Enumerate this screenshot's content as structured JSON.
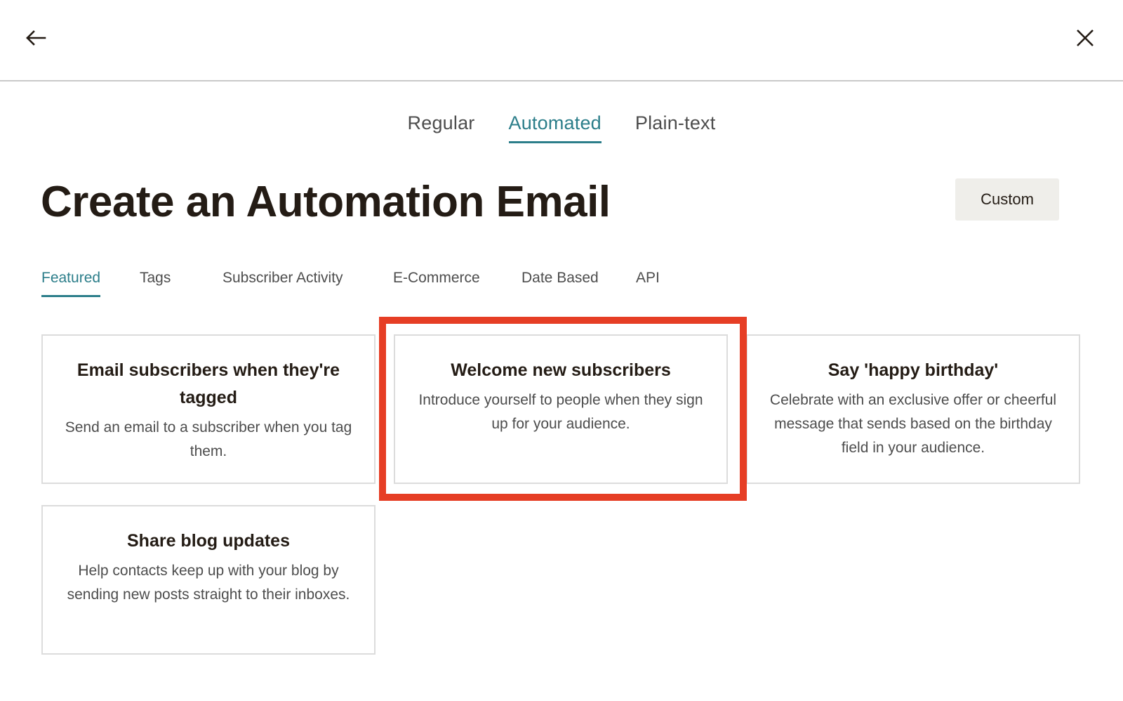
{
  "header": {
    "back_icon": "arrow-left-icon",
    "close_icon": "close-icon"
  },
  "type_tabs": [
    {
      "label": "Regular",
      "active": false
    },
    {
      "label": "Automated",
      "active": true
    },
    {
      "label": "Plain-text",
      "active": false
    }
  ],
  "page": {
    "title": "Create an Automation Email",
    "custom_button": "Custom"
  },
  "category_tabs": [
    {
      "label": "Featured",
      "active": true
    },
    {
      "label": "Tags",
      "active": false
    },
    {
      "label": "Subscriber Activity",
      "active": false
    },
    {
      "label": "E-Commerce",
      "active": false
    },
    {
      "label": "Date Based",
      "active": false
    },
    {
      "label": "API",
      "active": false
    }
  ],
  "cards": [
    {
      "title": "Email subscribers when they're tagged",
      "description": "Send an email to a subscriber when you tag them."
    },
    {
      "title": "Welcome new subscribers",
      "description": "Introduce yourself to people when they sign up for your audience."
    },
    {
      "title": "Say 'happy birthday'",
      "description": "Celebrate with an exclusive offer or cheerful message that sends based on the birthday field in your audience."
    },
    {
      "title": "Share blog updates",
      "description": "Help contacts keep up with your blog by sending new posts straight to their inboxes."
    }
  ],
  "colors": {
    "accent": "#2c7e8a",
    "highlight": "#e63e25",
    "button_bg": "#efeeea"
  }
}
